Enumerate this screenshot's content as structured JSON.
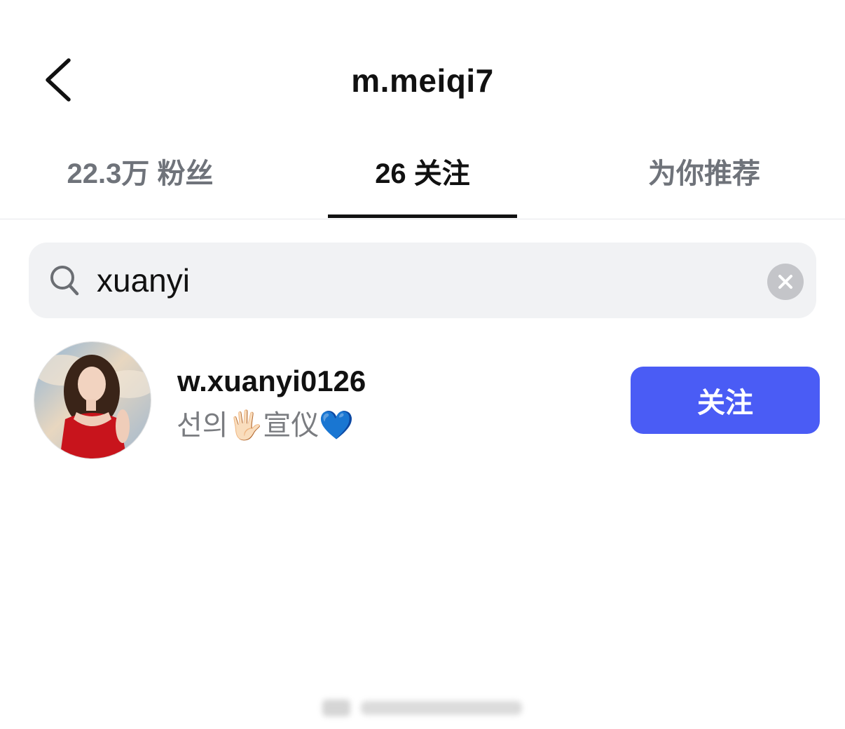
{
  "header": {
    "title": "m.meiqi7",
    "back_icon": "chevron-left-icon"
  },
  "tabs": [
    {
      "label": "22.3万 粉丝",
      "active": false
    },
    {
      "label": "26 关注",
      "active": true
    },
    {
      "label": "为你推荐",
      "active": false
    }
  ],
  "search": {
    "value": "xuanyi",
    "icon": "search-icon",
    "clear_icon": "clear-icon"
  },
  "results": [
    {
      "username": "w.xuanyi0126",
      "bio": "선의🖐🏻宣仪💙",
      "follow_label": "关注"
    }
  ],
  "colors": {
    "accent": "#4a5cf5",
    "muted_text": "#6f737a",
    "search_bg": "#f1f2f4"
  }
}
